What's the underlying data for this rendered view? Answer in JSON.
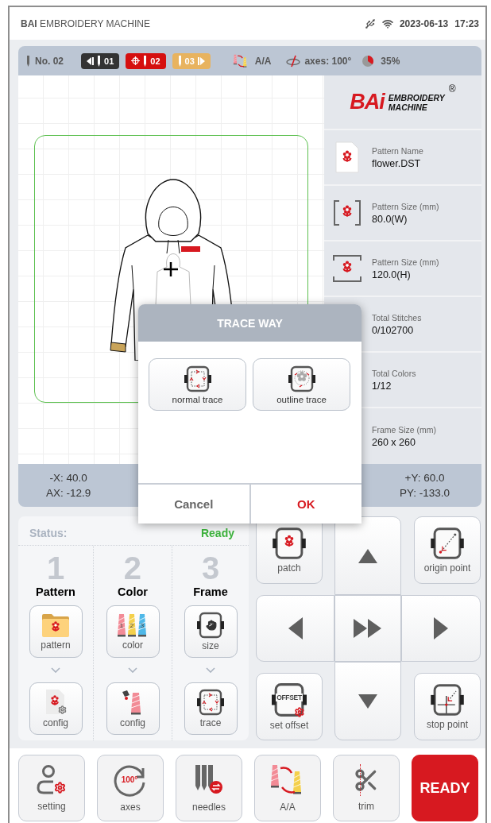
{
  "header": {
    "title": "**BAI** EMBROIDERY MACHINE",
    "date": "2023-06-13",
    "time": "17:23"
  },
  "toolbar": {
    "needle_no": "No. 02",
    "needles": [
      {
        "label": "01",
        "kind": "prev"
      },
      {
        "label": "02",
        "kind": "current"
      },
      {
        "label": "03",
        "kind": "next"
      }
    ],
    "thread_mode": "A/A",
    "axes": "axes: 100°",
    "progress": "35%"
  },
  "logo": {
    "brand": "BAi",
    "line1": "EMBROIDERY",
    "line2": "MACHINE",
    "mark": "®"
  },
  "info": [
    {
      "label": "Pattern Name",
      "value": "flower.DST",
      "kind": "file"
    },
    {
      "label": "Pattern Size (mm)",
      "value": "80.0(W)",
      "kind": "width"
    },
    {
      "label": "Pattern Size (mm)",
      "value": "120.0(H)",
      "kind": "height"
    },
    {
      "label": "Total Stitches",
      "value": "0/102700"
    },
    {
      "label": "Total Colors",
      "value": "1/12"
    },
    {
      "label": "Frame Size (mm)",
      "value": "260 x 260"
    }
  ],
  "coords": {
    "left": [
      "-X: 40.0",
      "AX: -12.9"
    ],
    "right": [
      "+Y: 60.0",
      "PY: -133.0"
    ]
  },
  "dialog": {
    "title": "TRACE WAY",
    "options": [
      {
        "label": "normal trace",
        "kind": "normal"
      },
      {
        "label": "outline trace",
        "kind": "outline"
      }
    ],
    "buttons": [
      {
        "label": "Cancel",
        "kind": "cancel"
      },
      {
        "label": "OK",
        "kind": "confirm"
      }
    ]
  },
  "status": {
    "label": "Status:",
    "value": "Ready"
  },
  "steps": [
    {
      "number": "1",
      "title": "Pattern",
      "buttons": [
        {
          "label": "pattern",
          "kind": "folder"
        },
        {
          "label": "config",
          "kind": "pattern-config"
        }
      ]
    },
    {
      "number": "2",
      "title": "Color",
      "buttons": [
        {
          "label": "color",
          "kind": "spools",
          "spool_labels": [
            "1",
            "2",
            "3"
          ]
        },
        {
          "label": "config",
          "kind": "color-config"
        }
      ]
    },
    {
      "number": "3",
      "title": "Frame",
      "buttons": [
        {
          "label": "size",
          "kind": "size"
        },
        {
          "label": "trace",
          "kind": "trace"
        }
      ]
    }
  ],
  "controls": [
    {
      "label": "patch",
      "kind": "patch"
    },
    {
      "label": "origin point",
      "kind": "origin"
    },
    {
      "label": "set offset",
      "kind": "offset",
      "icon_text": "OFFSET"
    },
    {
      "label": "stop point",
      "kind": "stop"
    }
  ],
  "bottom": [
    {
      "label": "setting",
      "kind": "setting"
    },
    {
      "label": "axes",
      "kind": "axes",
      "icon_text": "100°"
    },
    {
      "label": "needles",
      "kind": "needles"
    },
    {
      "label": "A/A",
      "kind": "threads"
    },
    {
      "label": "trim",
      "kind": "trim"
    },
    {
      "label": "READY",
      "kind": "primary"
    }
  ]
}
